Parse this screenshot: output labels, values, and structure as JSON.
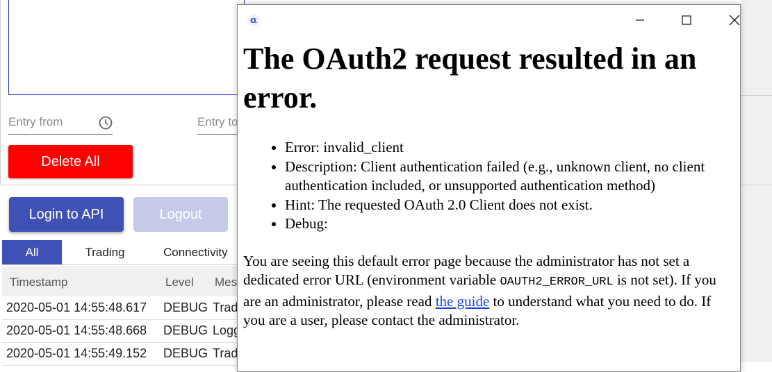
{
  "background": {
    "entry_from_label": "Entry from",
    "entry_to_label": "Entry to",
    "delete_all_label": "Delete All",
    "login_label": "Login to API",
    "logout_label": "Logout",
    "tabs": [
      {
        "label": "All",
        "active": true
      },
      {
        "label": "Trading",
        "active": false
      },
      {
        "label": "Connectivity",
        "active": false
      }
    ],
    "table": {
      "columns": [
        "Timestamp",
        "Level",
        "Mes"
      ],
      "rows": [
        {
          "timestamp": "2020-05-01 14:55:48.617",
          "level": "DEBUG",
          "message": "Trad"
        },
        {
          "timestamp": "2020-05-01 14:55:48.668",
          "level": "DEBUG",
          "message": "Logg"
        },
        {
          "timestamp": "2020-05-01 14:55:49.152",
          "level": "DEBUG",
          "message": "Trad"
        }
      ]
    },
    "colors": {
      "delete": "#ff0000",
      "primary": "#3f51b5",
      "disabled": "#c5cae9"
    }
  },
  "popup": {
    "app_icon_glyph": "α",
    "title": "The OAuth2 request resulted in an error.",
    "details": {
      "error": "Error: invalid_client",
      "description": "Description: Client authentication failed (e.g., unknown client, no client authentication included, or unsupported authentication method)",
      "hint": "Hint: The requested OAuth 2.0 Client does not exist.",
      "debug": "Debug:"
    },
    "paragraph": {
      "part1": "You are seeing this default error page because the administrator has not set a dedicated error URL (environment variable ",
      "code": "OAUTH2_ERROR_URL",
      "part2": " is not set). If you are an administrator, please read ",
      "link": "the guide",
      "part3": " to understand what you need to do. If you are a user, please contact the administrator."
    },
    "link_color": "#1a47d6"
  }
}
